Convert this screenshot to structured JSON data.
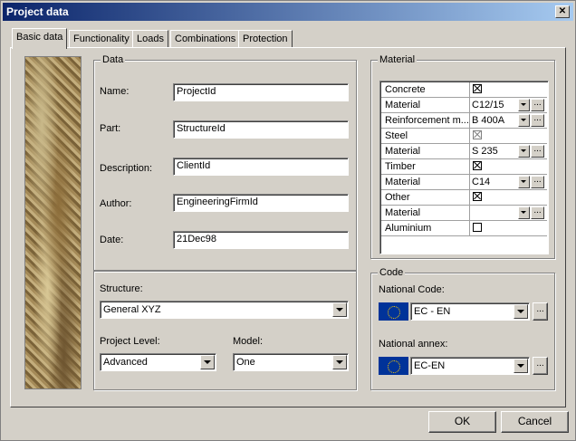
{
  "window": {
    "title": "Project data",
    "close_label": "✕"
  },
  "tabs": [
    {
      "label": "Basic data"
    },
    {
      "label": "Functionality"
    },
    {
      "label": "Loads"
    },
    {
      "label": "Combinations"
    },
    {
      "label": "Protection"
    }
  ],
  "data_group": {
    "title": "Data",
    "name_label": "Name:",
    "name_value": "ProjectId",
    "part_label": "Part:",
    "part_value": "StructureId",
    "description_label": "Description:",
    "description_value": "ClientId",
    "author_label": "Author:",
    "author_value": "EngineeringFirmId",
    "date_label": "Date:",
    "date_value": "21Dec98"
  },
  "structure_group": {
    "structure_label": "Structure:",
    "structure_value": "General XYZ",
    "project_level_label": "Project Level:",
    "project_level_value": "Advanced",
    "model_label": "Model:",
    "model_value": "One"
  },
  "material_group": {
    "title": "Material",
    "rows": [
      {
        "label": "Concrete",
        "type": "check",
        "checked": true
      },
      {
        "label": "Material",
        "type": "combo",
        "value": "C12/15"
      },
      {
        "label": "Reinforcement m...",
        "type": "combo",
        "value": "B 400A"
      },
      {
        "label": "Steel",
        "type": "check",
        "checked": true,
        "disabled": true
      },
      {
        "label": "Material",
        "type": "combo",
        "value": "S 235"
      },
      {
        "label": "Timber",
        "type": "check",
        "checked": true
      },
      {
        "label": "Material",
        "type": "combo",
        "value": "C14"
      },
      {
        "label": "Other",
        "type": "check",
        "checked": true
      },
      {
        "label": "Material",
        "type": "combo",
        "value": ""
      },
      {
        "label": "Aluminium",
        "type": "check",
        "checked": false
      }
    ]
  },
  "code_group": {
    "title": "Code",
    "national_code_label": "National Code:",
    "national_code_value": "EC - EN",
    "national_annex_label": "National annex:",
    "national_annex_value": "EC-EN",
    "browse_label": "..."
  },
  "buttons": {
    "ok": "OK",
    "cancel": "Cancel"
  },
  "colors": {
    "titlebar_start": "#0a246a",
    "titlebar_end": "#a6caf0",
    "face": "#d4d0c8",
    "eu_flag": "#003399"
  }
}
